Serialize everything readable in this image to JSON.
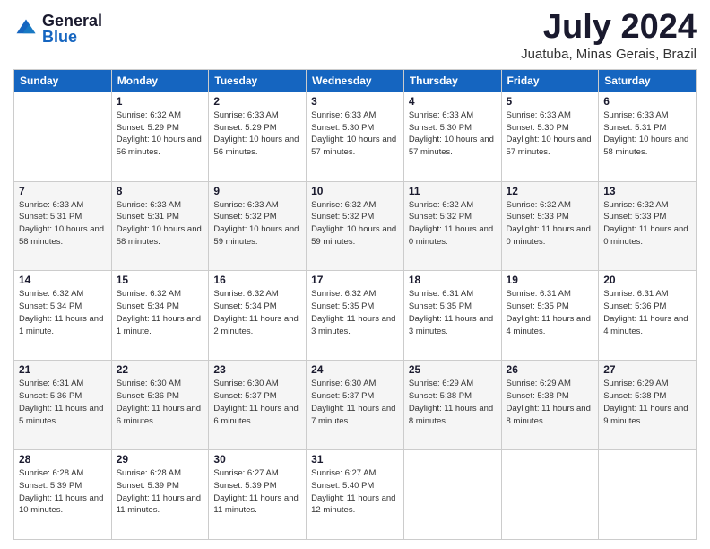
{
  "logo": {
    "general": "General",
    "blue": "Blue"
  },
  "title": "July 2024",
  "location": "Juatuba, Minas Gerais, Brazil",
  "headers": [
    "Sunday",
    "Monday",
    "Tuesday",
    "Wednesday",
    "Thursday",
    "Friday",
    "Saturday"
  ],
  "weeks": [
    [
      {
        "day": "",
        "info": ""
      },
      {
        "day": "1",
        "info": "Sunrise: 6:32 AM\nSunset: 5:29 PM\nDaylight: 10 hours\nand 56 minutes."
      },
      {
        "day": "2",
        "info": "Sunrise: 6:33 AM\nSunset: 5:29 PM\nDaylight: 10 hours\nand 56 minutes."
      },
      {
        "day": "3",
        "info": "Sunrise: 6:33 AM\nSunset: 5:30 PM\nDaylight: 10 hours\nand 57 minutes."
      },
      {
        "day": "4",
        "info": "Sunrise: 6:33 AM\nSunset: 5:30 PM\nDaylight: 10 hours\nand 57 minutes."
      },
      {
        "day": "5",
        "info": "Sunrise: 6:33 AM\nSunset: 5:30 PM\nDaylight: 10 hours\nand 57 minutes."
      },
      {
        "day": "6",
        "info": "Sunrise: 6:33 AM\nSunset: 5:31 PM\nDaylight: 10 hours\nand 58 minutes."
      }
    ],
    [
      {
        "day": "7",
        "info": "Sunrise: 6:33 AM\nSunset: 5:31 PM\nDaylight: 10 hours\nand 58 minutes."
      },
      {
        "day": "8",
        "info": "Sunrise: 6:33 AM\nSunset: 5:31 PM\nDaylight: 10 hours\nand 58 minutes."
      },
      {
        "day": "9",
        "info": "Sunrise: 6:33 AM\nSunset: 5:32 PM\nDaylight: 10 hours\nand 59 minutes."
      },
      {
        "day": "10",
        "info": "Sunrise: 6:32 AM\nSunset: 5:32 PM\nDaylight: 10 hours\nand 59 minutes."
      },
      {
        "day": "11",
        "info": "Sunrise: 6:32 AM\nSunset: 5:32 PM\nDaylight: 11 hours\nand 0 minutes."
      },
      {
        "day": "12",
        "info": "Sunrise: 6:32 AM\nSunset: 5:33 PM\nDaylight: 11 hours\nand 0 minutes."
      },
      {
        "day": "13",
        "info": "Sunrise: 6:32 AM\nSunset: 5:33 PM\nDaylight: 11 hours\nand 0 minutes."
      }
    ],
    [
      {
        "day": "14",
        "info": "Sunrise: 6:32 AM\nSunset: 5:34 PM\nDaylight: 11 hours\nand 1 minute."
      },
      {
        "day": "15",
        "info": "Sunrise: 6:32 AM\nSunset: 5:34 PM\nDaylight: 11 hours\nand 1 minute."
      },
      {
        "day": "16",
        "info": "Sunrise: 6:32 AM\nSunset: 5:34 PM\nDaylight: 11 hours\nand 2 minutes."
      },
      {
        "day": "17",
        "info": "Sunrise: 6:32 AM\nSunset: 5:35 PM\nDaylight: 11 hours\nand 3 minutes."
      },
      {
        "day": "18",
        "info": "Sunrise: 6:31 AM\nSunset: 5:35 PM\nDaylight: 11 hours\nand 3 minutes."
      },
      {
        "day": "19",
        "info": "Sunrise: 6:31 AM\nSunset: 5:35 PM\nDaylight: 11 hours\nand 4 minutes."
      },
      {
        "day": "20",
        "info": "Sunrise: 6:31 AM\nSunset: 5:36 PM\nDaylight: 11 hours\nand 4 minutes."
      }
    ],
    [
      {
        "day": "21",
        "info": "Sunrise: 6:31 AM\nSunset: 5:36 PM\nDaylight: 11 hours\nand 5 minutes."
      },
      {
        "day": "22",
        "info": "Sunrise: 6:30 AM\nSunset: 5:36 PM\nDaylight: 11 hours\nand 6 minutes."
      },
      {
        "day": "23",
        "info": "Sunrise: 6:30 AM\nSunset: 5:37 PM\nDaylight: 11 hours\nand 6 minutes."
      },
      {
        "day": "24",
        "info": "Sunrise: 6:30 AM\nSunset: 5:37 PM\nDaylight: 11 hours\nand 7 minutes."
      },
      {
        "day": "25",
        "info": "Sunrise: 6:29 AM\nSunset: 5:38 PM\nDaylight: 11 hours\nand 8 minutes."
      },
      {
        "day": "26",
        "info": "Sunrise: 6:29 AM\nSunset: 5:38 PM\nDaylight: 11 hours\nand 8 minutes."
      },
      {
        "day": "27",
        "info": "Sunrise: 6:29 AM\nSunset: 5:38 PM\nDaylight: 11 hours\nand 9 minutes."
      }
    ],
    [
      {
        "day": "28",
        "info": "Sunrise: 6:28 AM\nSunset: 5:39 PM\nDaylight: 11 hours\nand 10 minutes."
      },
      {
        "day": "29",
        "info": "Sunrise: 6:28 AM\nSunset: 5:39 PM\nDaylight: 11 hours\nand 11 minutes."
      },
      {
        "day": "30",
        "info": "Sunrise: 6:27 AM\nSunset: 5:39 PM\nDaylight: 11 hours\nand 11 minutes."
      },
      {
        "day": "31",
        "info": "Sunrise: 6:27 AM\nSunset: 5:40 PM\nDaylight: 11 hours\nand 12 minutes."
      },
      {
        "day": "",
        "info": ""
      },
      {
        "day": "",
        "info": ""
      },
      {
        "day": "",
        "info": ""
      }
    ]
  ]
}
